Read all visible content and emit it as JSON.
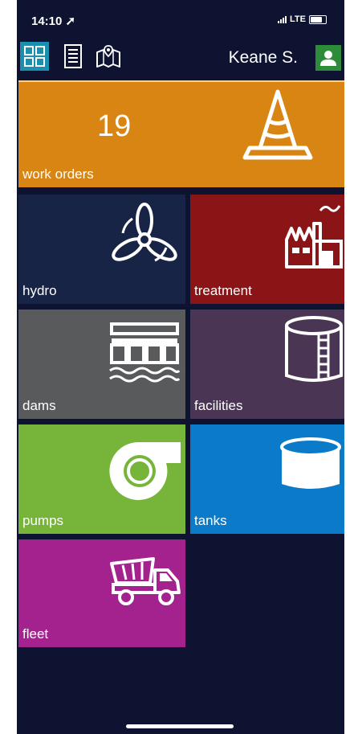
{
  "status_bar": {
    "time": "14:10",
    "network": "LTE"
  },
  "toolbar": {
    "user_name": "Keane S."
  },
  "work_orders": {
    "count": "19",
    "label": "work orders",
    "color": "#d88513"
  },
  "tiles": [
    {
      "label": "hydro",
      "color": "#172446",
      "icon": "propeller-icon"
    },
    {
      "label": "treatment",
      "color": "#8b1516",
      "icon": "factory-icon"
    },
    {
      "label": "dams",
      "color": "#585a5c",
      "icon": "dam-icon"
    },
    {
      "label": "facilities",
      "color": "#4a3654",
      "icon": "storage-tank-icon"
    },
    {
      "label": "pumps",
      "color": "#76b43a",
      "icon": "pump-icon"
    },
    {
      "label": "tanks",
      "color": "#0b7bc9",
      "icon": "tank-icon"
    },
    {
      "label": "fleet",
      "color": "#a4228e",
      "icon": "dump-truck-icon"
    }
  ]
}
